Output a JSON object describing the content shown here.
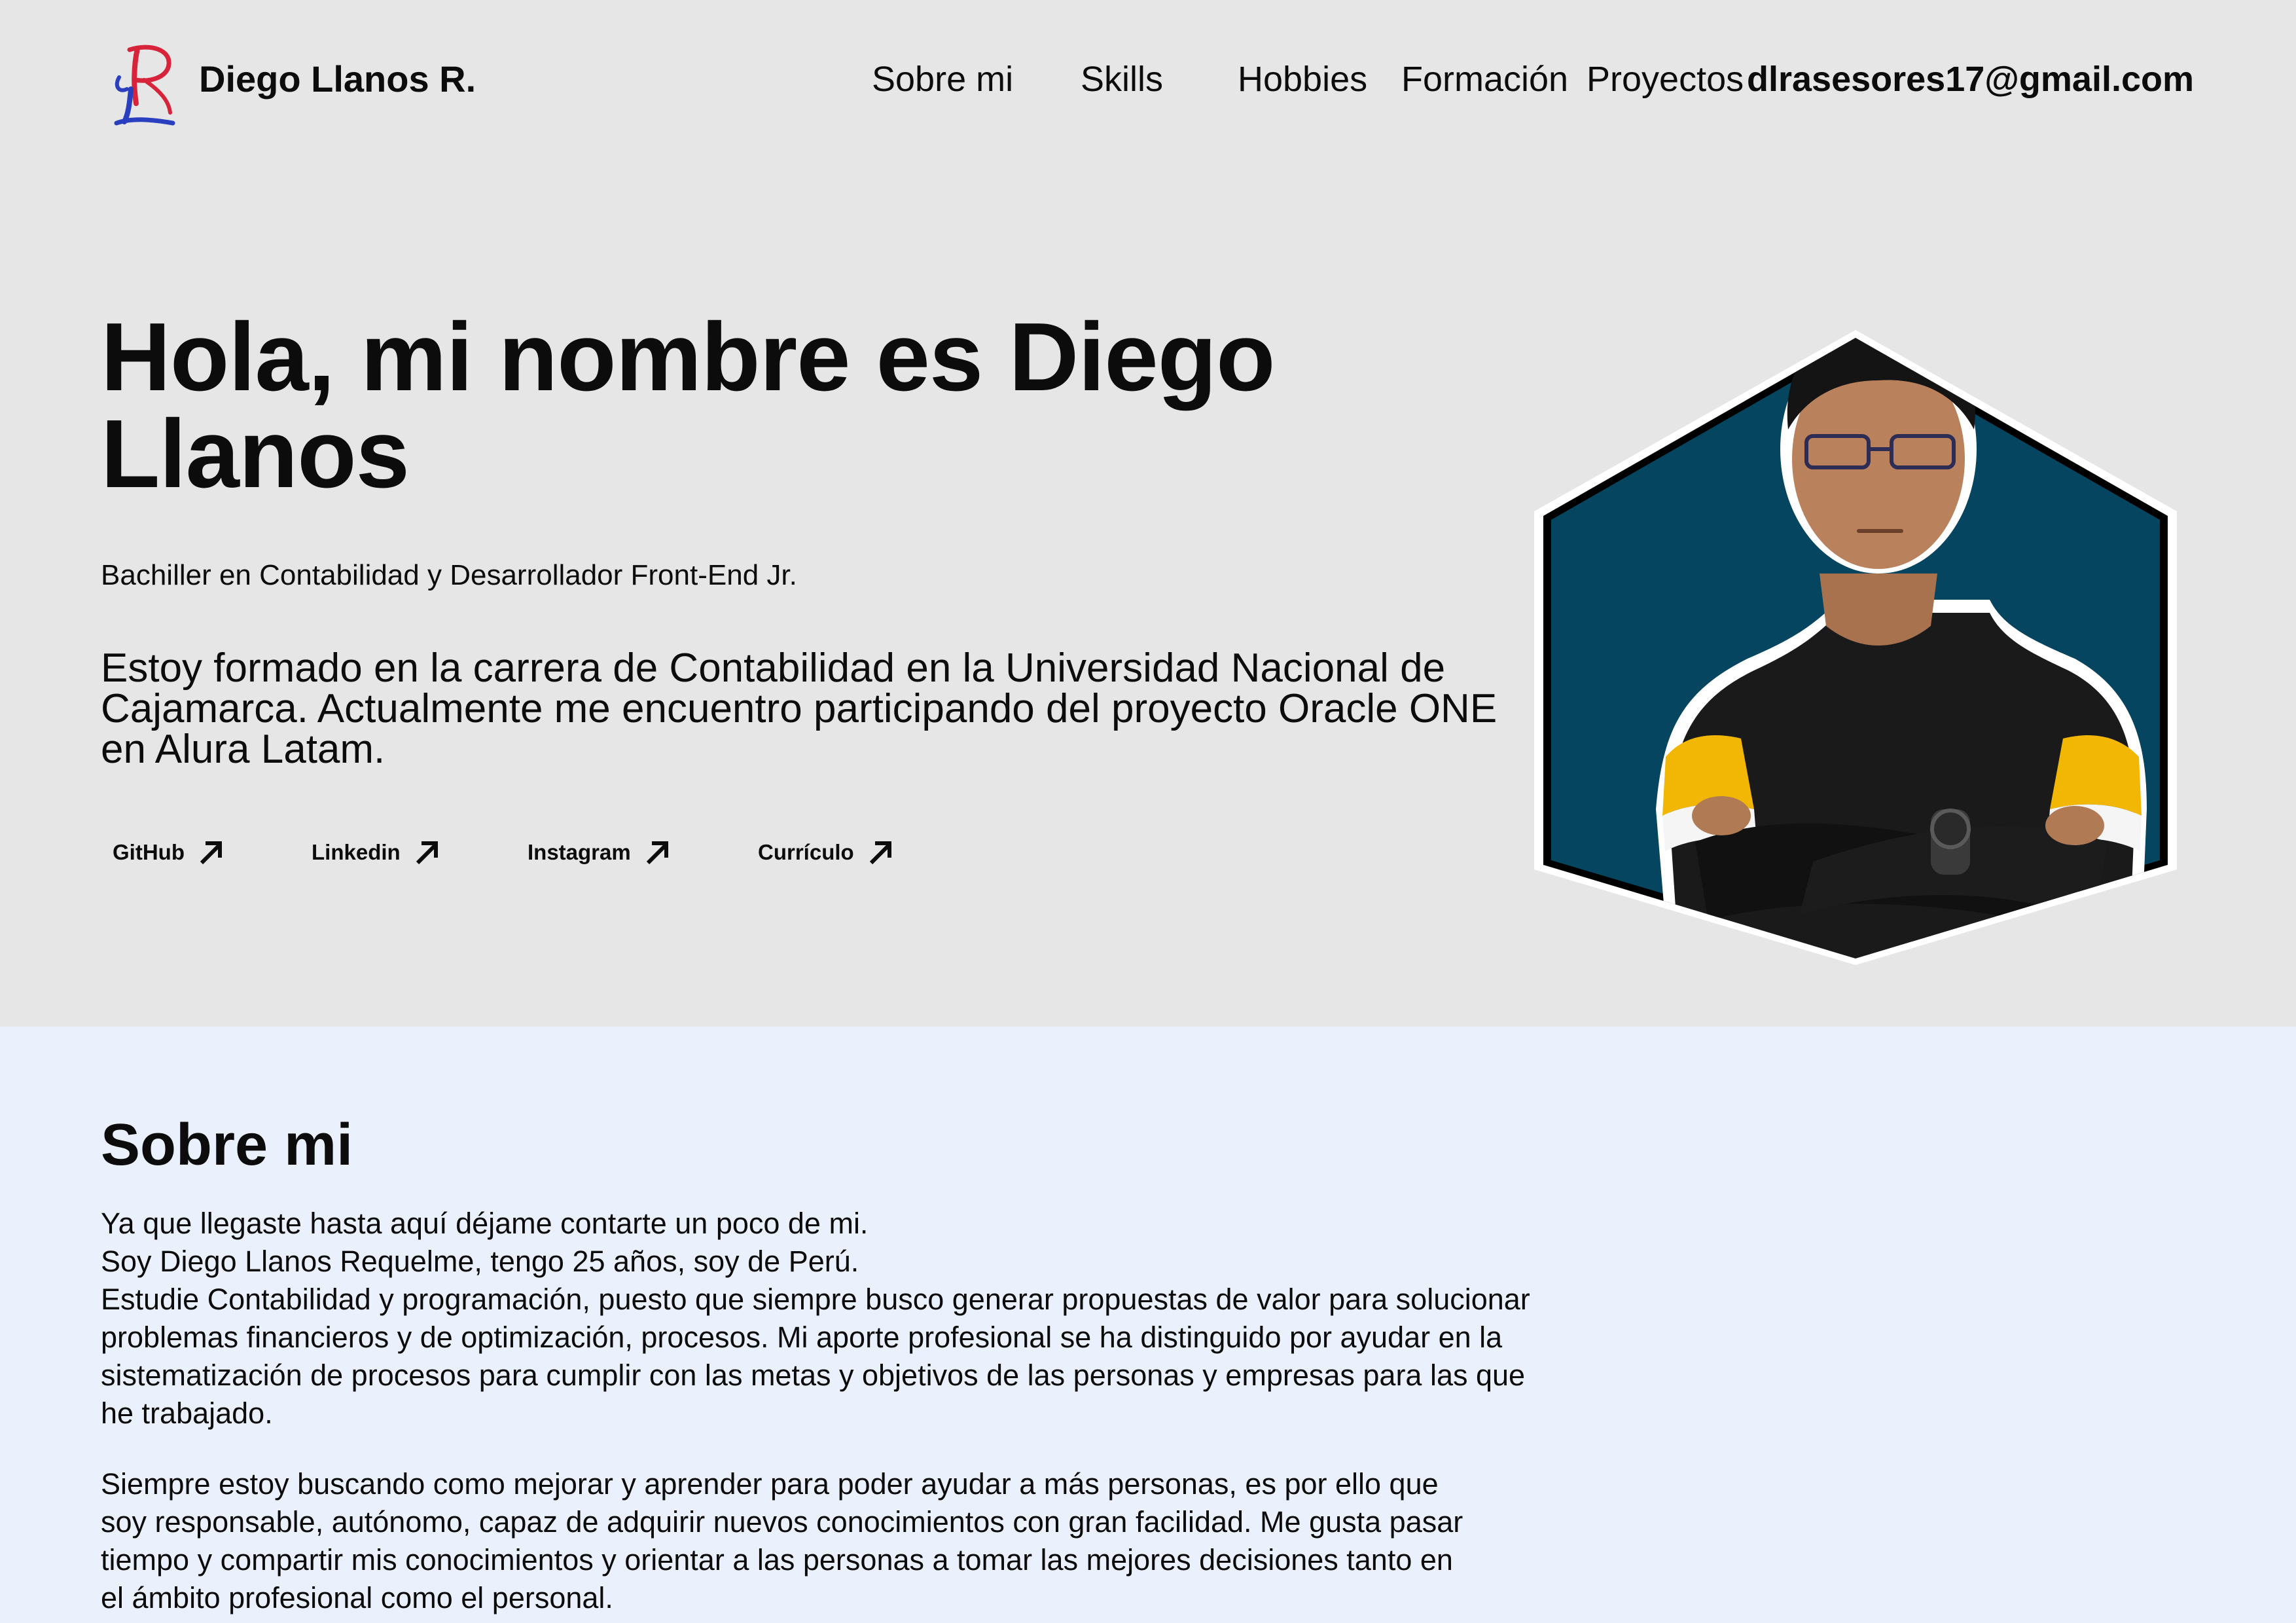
{
  "header": {
    "brand": "Diego Llanos R.",
    "nav": [
      "Sobre mi",
      "Skills",
      "Hobbies",
      "Formación",
      "Proyectos"
    ],
    "email": "dlrasesores17@gmail.com"
  },
  "hero": {
    "title": "Hola, mi nombre es Diego Llanos",
    "subtitle": "Bachiller en Contabilidad y Desarrollador Front-End Jr.",
    "description": "Estoy formado en la carrera de Contabilidad en la Universidad Nacional de Cajamarca. Actualmente me encuentro participando del proyecto Oracle ONE en Alura Latam.",
    "links": [
      "GitHub",
      "Linkedin",
      "Instagram",
      "Currículo"
    ],
    "link_icon": "arrow-up-right-icon"
  },
  "about": {
    "title": "Sobre mi",
    "paragraph1_lines": [
      "Ya que llegaste hasta aquí déjame contarte un poco de mi.",
      "Soy Diego Llanos Requelme, tengo 25 años, soy de Perú.",
      "Estudie Contabilidad y programación, puesto que siempre busco generar propuestas de valor para solucionar problemas financieros y de optimización, procesos. Mi aporte profesional se ha distinguido por ayudar en la sistematización de procesos para cumplir con las metas y objetivos de las personas y empresas para las que he trabajado."
    ],
    "paragraph2": "Siempre estoy buscando como mejorar y aprender para poder ayudar a más personas, es por ello que soy responsable, autónomo, capaz de adquirir nuevos conocimientos con gran facilidad. Me gusta pasar tiempo y compartir mis conocimientos y orientar a las personas a tomar las mejores decisiones tanto en el ámbito profesional como el personal."
  },
  "colors": {
    "hero_bg": "#e6e6e6",
    "about_bg": "#ebf1fc",
    "hexagon_fill": "#05455f",
    "text": "#0c0c0c",
    "logo_red": "#d8243a",
    "logo_blue": "#2a3fbf"
  }
}
